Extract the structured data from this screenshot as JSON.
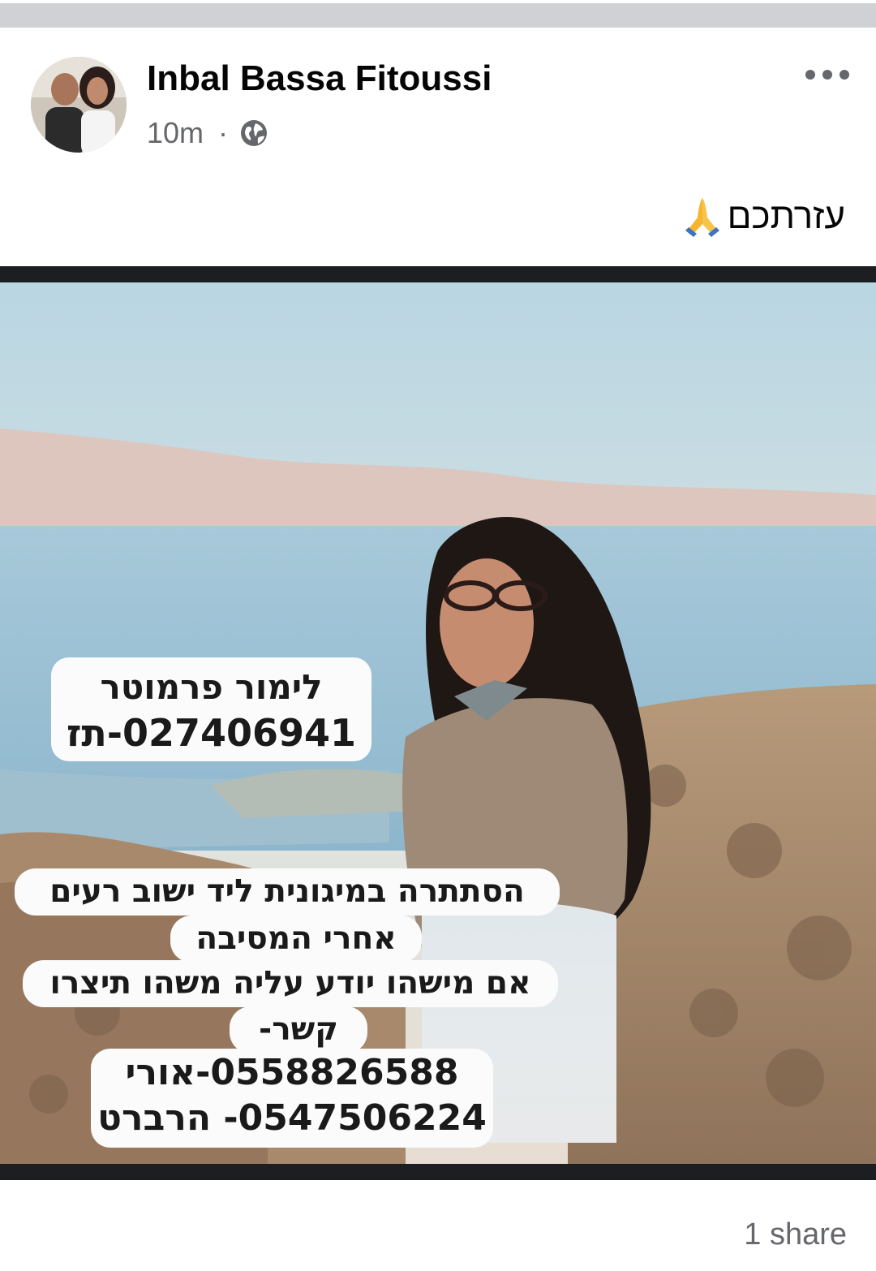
{
  "post": {
    "author_name": "Inbal Bassa Fitoussi",
    "time_ago": "10m",
    "separator": "·",
    "privacy_icon": "globe-icon",
    "text": "עזרתכם",
    "text_emoji": "folded-hands-icon",
    "more_icon": "more-dots-icon"
  },
  "image_overlay": {
    "name_line": "לימור פרמוטר",
    "id_line": "027406941-תז",
    "message_lines": [
      "הסתתרה במיגונית ליד ישוב רעים",
      "אחרי המסיבה",
      "אם מישהו יודע עליה משהו תיצרו",
      "קשר-"
    ],
    "phone_lines": [
      "0558826588-אורי",
      "0547506224- הרברט"
    ]
  },
  "footer": {
    "shares_label": "1 share"
  },
  "colors": {
    "name_text": "#050505",
    "meta_text": "#65676b",
    "photo_frame": "#1c1e21",
    "top_strip": "#cfd1d5"
  }
}
